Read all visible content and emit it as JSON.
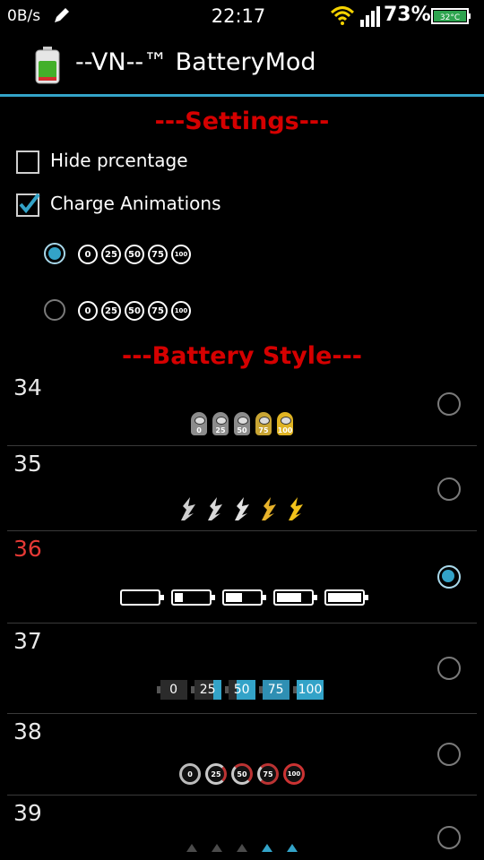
{
  "status_bar": {
    "net_speed": "0B/s",
    "time": "22:17",
    "battery_percent": "73%",
    "battery_temp": "32°C",
    "icons": [
      "pencil-icon",
      "wifi-icon",
      "signal-icon",
      "battery-icon"
    ]
  },
  "app": {
    "title": "--VN--™ BatteryMod",
    "accent_color": "#33a3c8",
    "header_color": "#d50000"
  },
  "settings": {
    "heading": "---Settings---",
    "hide_percentage": {
      "label": "Hide prcentage",
      "checked": false
    },
    "charge_animations": {
      "label": "Charge Animations",
      "checked": true
    },
    "animation_options": [
      {
        "selected": true,
        "labels": [
          "0",
          "25",
          "50",
          "75",
          "100"
        ]
      },
      {
        "selected": false,
        "labels": [
          "0",
          "25",
          "50",
          "75",
          "100"
        ]
      }
    ]
  },
  "battery_style": {
    "heading": "---Battery Style---",
    "selected": "36",
    "items": [
      {
        "number": "34",
        "preview": "minions",
        "labels": [
          "0",
          "25",
          "50",
          "75",
          "100"
        ]
      },
      {
        "number": "35",
        "preview": "flames"
      },
      {
        "number": "36",
        "preview": "outline-batteries",
        "levels": [
          0,
          0.25,
          0.5,
          0.75,
          1.0
        ]
      },
      {
        "number": "37",
        "preview": "boxed-numbers",
        "labels": [
          "0",
          "25",
          "50",
          "75",
          "100"
        ]
      },
      {
        "number": "38",
        "preview": "rings",
        "labels": [
          "0",
          "25",
          "50",
          "75",
          "100"
        ]
      },
      {
        "number": "39",
        "preview": "triangles"
      }
    ]
  }
}
